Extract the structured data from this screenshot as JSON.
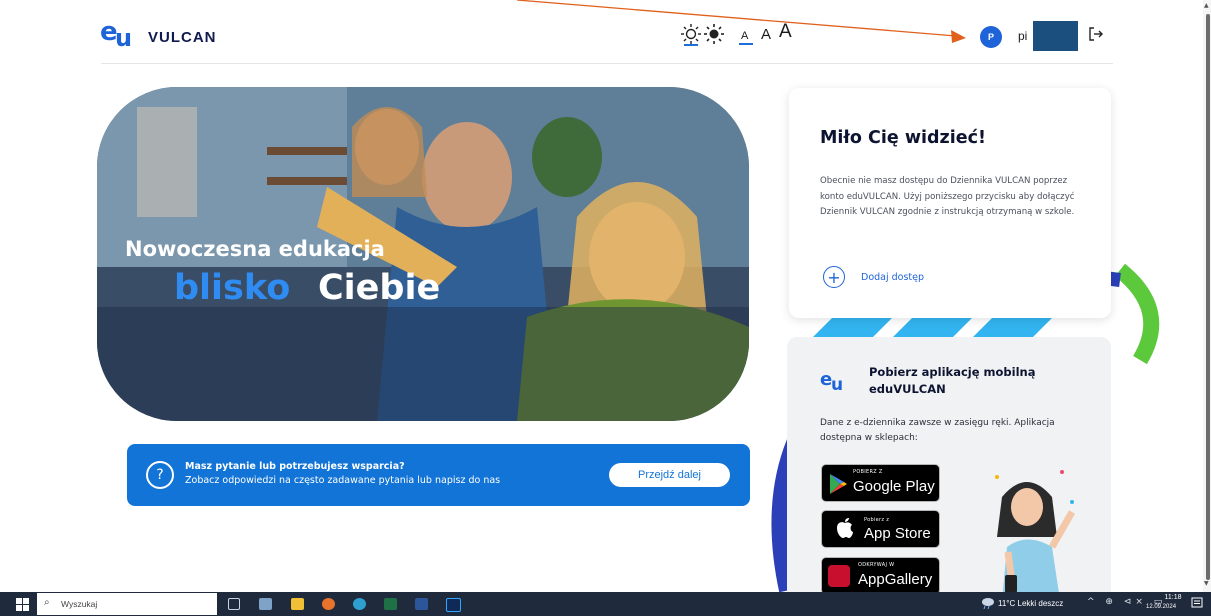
{
  "header": {
    "logo_text": "VULCAN",
    "font_size_options": [
      "A",
      "A",
      "A"
    ],
    "user": {
      "initial": "P",
      "name_visible": "pi"
    }
  },
  "hero": {
    "line1": "Nowoczesna edukacja",
    "line2_highlight": "blisko",
    "line2_rest": "Ciebie"
  },
  "faq": {
    "icon": "?",
    "title": "Masz pytanie lub potrzebujesz wsparcia?",
    "subtitle": "Zobacz odpowiedzi na często zadawane pytania lub napisz do nas",
    "button_label": "Przejdź dalej"
  },
  "welcome_card": {
    "title": "Miło Cię widzieć!",
    "body": "Obecnie nie masz dostępu do Dziennika VULCAN poprzez konto eduVULCAN. Użyj poniższego przycisku aby dołączyć Dziennik VULCAN zgodnie z instrukcją otrzymaną w szkole.",
    "add_icon": "+",
    "add_label": "Dodaj dostęp"
  },
  "app_card": {
    "title": "Pobierz aplikację mobilną eduVULCAN",
    "body": "Dane z e-dziennika zawsze w zasięgu ręki. Aplikacja dostępna w sklepach:",
    "stores": [
      {
        "small": "POBIERZ Z",
        "big": "Google Play"
      },
      {
        "small": "Pobierz z",
        "big": "App Store"
      },
      {
        "small": "ODKRYWAJ W",
        "big": "AppGallery"
      }
    ]
  },
  "taskbar": {
    "search_placeholder": "Wyszukaj",
    "weather": "11°C  Lekki deszcz",
    "tray_icons": "^ ⊕ ⊲× ▭",
    "time": "11:18",
    "date": "12.09.2024"
  },
  "colors": {
    "accent": "#1e63d8",
    "faq_bg": "#1274d6",
    "hero_highlight": "#2f8cf3",
    "annotation_arrow": "#e0601c",
    "taskbar_bg": "#1f2a3d"
  },
  "icons": {
    "contrast_light": "sun-icon",
    "contrast_dark": "sun-dark-icon",
    "logout": "logout-icon",
    "faq": "question-icon",
    "add": "plus-icon"
  }
}
